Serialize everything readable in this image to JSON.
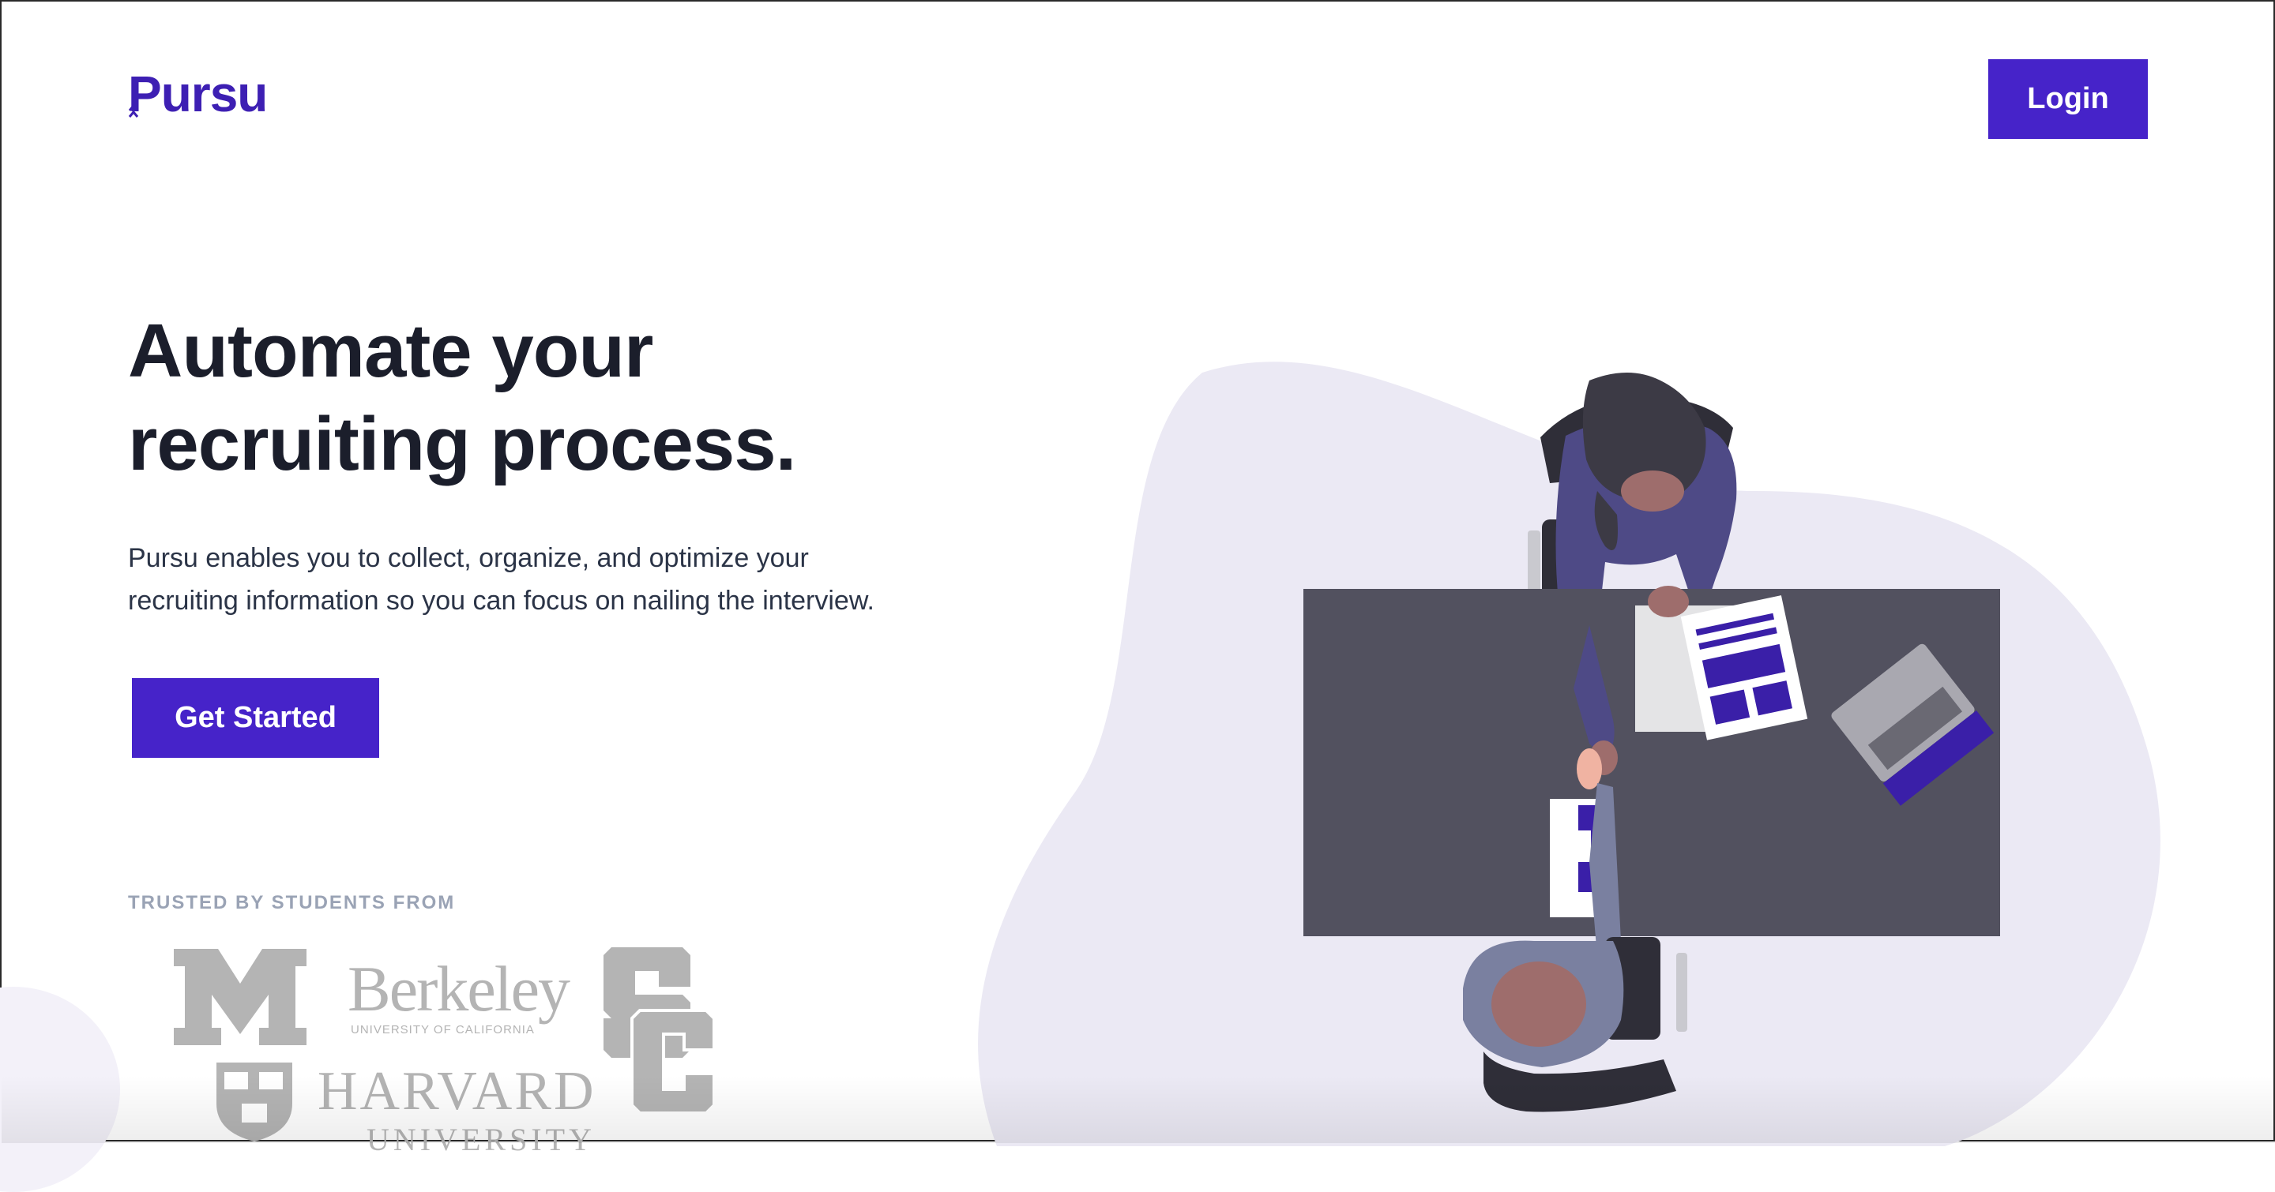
{
  "brand": {
    "name": "Pursu",
    "color": "#3d1fb3"
  },
  "header": {
    "login_label": "Login"
  },
  "hero": {
    "headline_line1": "Automate your",
    "headline_line2": "recruiting process.",
    "description_line1": "Pursu enables you to collect, organize, and optimize your",
    "description_line2": "recruiting information so you can focus on nailing the interview.",
    "cta_label": "Get Started"
  },
  "trusted": {
    "label": "TRUSTED BY STUDENTS FROM",
    "logos": [
      {
        "name": "University of Michigan",
        "icon": "block-m-logo"
      },
      {
        "name": "Berkeley",
        "subtitle": "UNIVERSITY OF CALIFORNIA",
        "icon": "berkeley-wordmark"
      },
      {
        "name": "USC",
        "icon": "interlocking-sc-logo"
      },
      {
        "name": "HARVARD",
        "subtitle": "UNIVERSITY",
        "icon": "harvard-shield"
      }
    ]
  },
  "illustration": {
    "icon": "handshake-meeting-illustration"
  },
  "colors": {
    "accent": "#4623c9",
    "heading": "#1b1e2b",
    "body": "#2b3447",
    "muted": "#9aa3b5",
    "blob": "#ebe9f4",
    "logo_gray": "#b4b4b4"
  }
}
